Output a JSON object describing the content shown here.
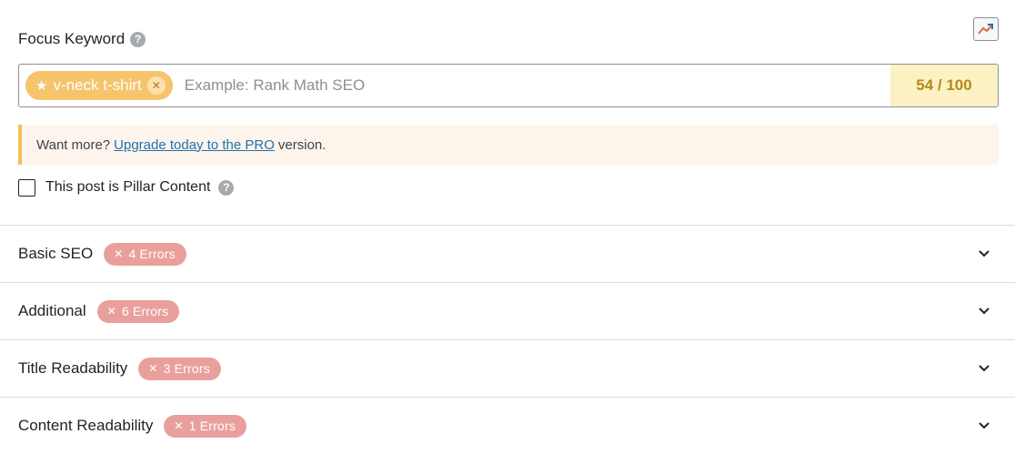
{
  "focus_keyword": {
    "label": "Focus Keyword",
    "help_icon": "question-circle-icon",
    "trend_icon": "trend-chart-icon",
    "tag": {
      "icon": "star-icon",
      "text": "v-neck t-shirt",
      "remove_icon": "close-icon"
    },
    "input_placeholder": "Example: Rank Math SEO",
    "input_value": "",
    "score": "54 / 100"
  },
  "notice": {
    "prefix": "Want more?",
    "link": "Upgrade today to the PRO",
    "suffix": "version."
  },
  "pillar": {
    "label": "This post is Pillar Content",
    "checked": false
  },
  "sections": [
    {
      "title": "Basic SEO",
      "badge": "4 Errors"
    },
    {
      "title": "Additional",
      "badge": "6 Errors"
    },
    {
      "title": "Title Readability",
      "badge": "3 Errors"
    },
    {
      "title": "Content Readability",
      "badge": "1 Errors"
    }
  ],
  "colors": {
    "tag_bg": "#f5c46b",
    "score_bg": "#fcf1c2",
    "score_text": "#b78a1c",
    "notice_bg": "#fdf5ec",
    "notice_border": "#f0c15a",
    "error_badge": "#e9a09c",
    "link": "#2271b1"
  }
}
